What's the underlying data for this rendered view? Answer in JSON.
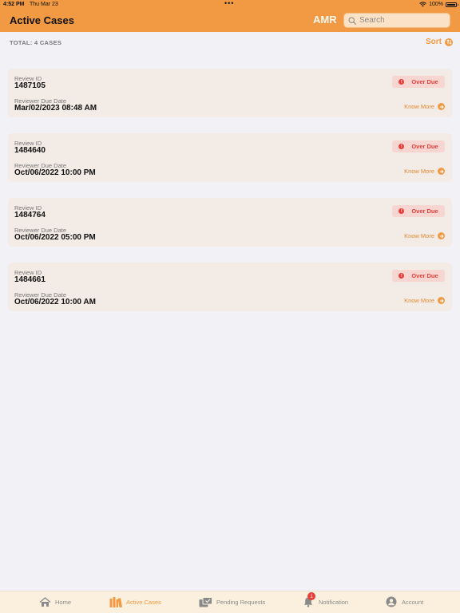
{
  "status_bar": {
    "time": "4:52 PM",
    "date": "Thu Mar 23",
    "battery": "100%"
  },
  "header": {
    "title": "Active Cases",
    "logo_text": "AMR",
    "search_placeholder": "Search"
  },
  "summary": {
    "total_label": "TOTAL: 4 CASES",
    "sort_label": "Sort"
  },
  "labels": {
    "review_id": "Review ID",
    "due_date": "Reviewer Due Date",
    "know_more": "Know More"
  },
  "cases": [
    {
      "review_id": "1487105",
      "due_date": "Mar/02/2023 08:48 AM",
      "status": "Over Due"
    },
    {
      "review_id": "1484640",
      "due_date": "Oct/06/2022 10:00 PM",
      "status": "Over Due"
    },
    {
      "review_id": "1484764",
      "due_date": "Oct/06/2022 05:00 PM",
      "status": "Over Due"
    },
    {
      "review_id": "1484661",
      "due_date": "Oct/06/2022 10:00 AM",
      "status": "Over Due"
    }
  ],
  "tabbar": {
    "items": [
      {
        "label": "Home",
        "icon": "home-icon"
      },
      {
        "label": "Active Cases",
        "icon": "books-icon",
        "active": true
      },
      {
        "label": "Pending Requests",
        "icon": "pending-requests-icon"
      },
      {
        "label": "Notification",
        "icon": "bell-icon",
        "badge": "1"
      },
      {
        "label": "Account",
        "icon": "account-icon"
      }
    ]
  },
  "colors": {
    "accent": "#f19a43",
    "overdue": "#e63f3b",
    "card_bg": "#f3ebe6",
    "page_bg": "#f2f1f6"
  }
}
